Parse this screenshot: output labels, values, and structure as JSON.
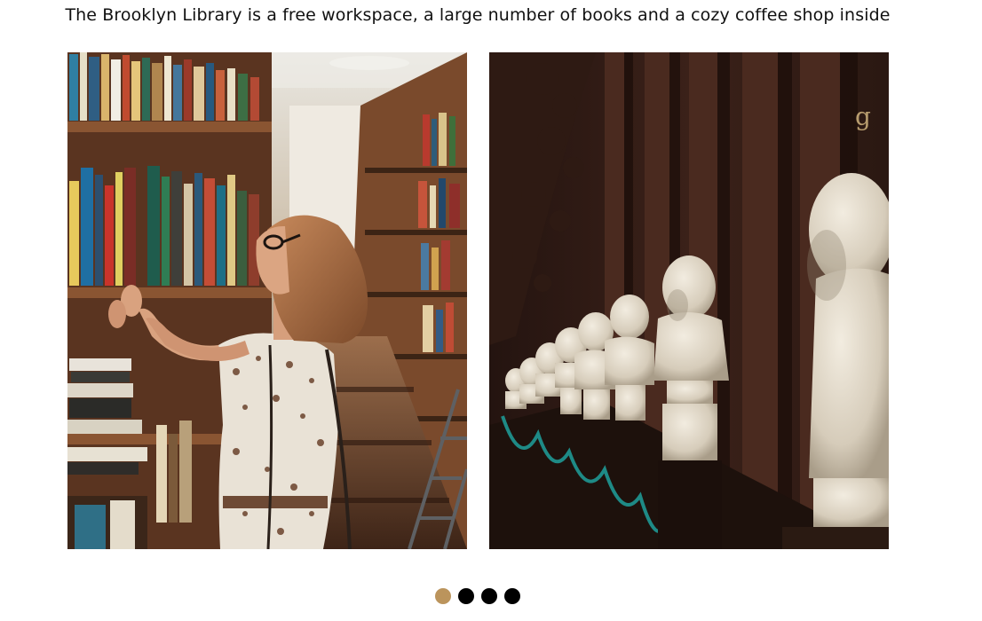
{
  "caption": "The Brooklyn Library is a free workspace, a large number of books and a cozy coffee shop inside",
  "slider": {
    "total_slides": 4,
    "active_index": 0,
    "active_color": "#bb945c",
    "inactive_color": "#000000"
  },
  "colors": {
    "text": "#111111",
    "background": "#ffffff"
  }
}
